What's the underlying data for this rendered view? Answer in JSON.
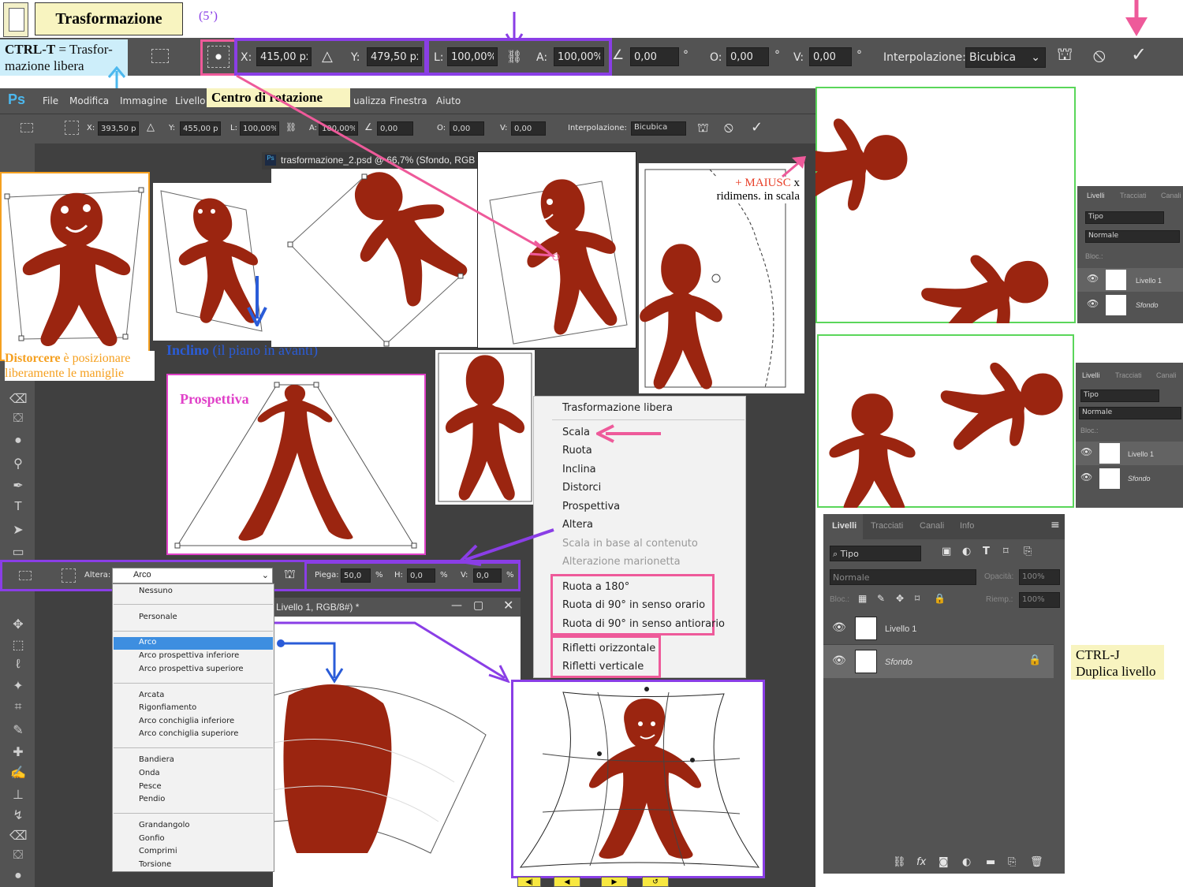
{
  "header": {
    "title": "Trasformazione",
    "time_note": "(5’)",
    "shortcut_key": "CTRL-T",
    "shortcut_desc_1": " = Trasfor-",
    "shortcut_desc_2": "mazione libera"
  },
  "options_bar": {
    "x_label": "X:",
    "x_value": "415,00 px",
    "y_label": "Y:",
    "y_value": "479,50 px",
    "w_label": "L:",
    "w_value": "100,00%",
    "h_label": "A:",
    "h_value": "100,00%",
    "angle_value": "0,00",
    "deg": "°",
    "hskew_label": "O:",
    "hskew_value": "0,00",
    "vskew_label": "V:",
    "vskew_value": "0,00",
    "interp_label": "Interpolazione:",
    "interp_value": "Bicubica"
  },
  "ps_menu": {
    "logo": "Ps",
    "items": [
      "File",
      "Modifica",
      "Immagine",
      "Livello",
      "Visualizza",
      "Finestra",
      "Aiuto"
    ],
    "items_suffix": "ualizza"
  },
  "small_options_bar": {
    "x_label": "X:",
    "x_value": "393,50 px",
    "y_label": "Y:",
    "y_value": "455,00 px",
    "w_label": "L:",
    "w_value": "100,00%",
    "h_label": "A:",
    "h_value": "100,00%",
    "angle_value": "0,00",
    "hskew_label": "O:",
    "hskew_value": "0,00",
    "vskew_label": "V:",
    "vskew_value": "0,00",
    "interp_label": "Interpolazione:",
    "interp_value": "Bicubica"
  },
  "callouts": {
    "rotation_center": "Centro di rotazione",
    "shift_1": "+ MAIUSC",
    "shift_2": " x",
    "shift_3": "ridimens. in scala",
    "distort_bold": "Distorcere",
    "distort_rest": " è posizionare",
    "distort_line2": "liberamente le maniglie",
    "skew_bold": "Inclino",
    "skew_rest": " (il piano in avanti)",
    "perspective": "Prospettiva",
    "ctrlj_1": "CTRL-J",
    "ctrlj_2": "Duplica livello"
  },
  "doc_tab": {
    "title": "trasformazione_2.psd @ 66,7% (Sfondo, RGB",
    "title2": "Livello 1, RGB/8#) *"
  },
  "context_menu": {
    "items": [
      "Trasformazione libera",
      "Scala",
      "Ruota",
      "Inclina",
      "Distorci",
      "Prospettiva",
      "Altera"
    ],
    "disabled": [
      "Scala in base al contenuto",
      "Alterazione marionetta"
    ],
    "rotate": [
      "Ruota a 180°",
      "Ruota di 90° in senso orario",
      "Ruota di 90° in senso antiorario"
    ],
    "flip": [
      "Rifletti orizzontale",
      "Rifletti verticale"
    ]
  },
  "warp_bar": {
    "label": "Altera:",
    "value": "Arco",
    "bend_label": "Piega:",
    "bend_value": "50,0",
    "pct": "%",
    "h_label": "H:",
    "h_value": "0,0",
    "v_label": "V:",
    "v_value": "0,0"
  },
  "warp_menu": {
    "none": "Nessuno",
    "custom": "Personale",
    "group1": [
      "Arco",
      "Arco prospettiva inferiore",
      "Arco prospettiva superiore"
    ],
    "group2": [
      "Arcata",
      "Rigonfiamento",
      "Arco conchiglia inferiore",
      "Arco conchiglia superiore"
    ],
    "group3": [
      "Bandiera",
      "Onda",
      "Pesce",
      "Pendio"
    ],
    "group4": [
      "Grandangolo",
      "Gonfio",
      "Comprimi",
      "Torsione"
    ]
  },
  "layers_small": {
    "tabs": [
      "Livelli",
      "Tracciati",
      "Canali"
    ],
    "filter": "Tipo",
    "blend": "Normale",
    "lock": "Bloc.:",
    "layer1": "Livello 1",
    "background": "Sfondo"
  },
  "layers_panel": {
    "tabs": [
      "Livelli",
      "Tracciati",
      "Canali",
      "Info"
    ],
    "filter": "Tipo",
    "blend": "Normale",
    "opacity_label": "Opacità:",
    "opacity_value": "100%",
    "lock_label": "Bloc.:",
    "fill_label": "Riemp.:",
    "fill_value": "100%",
    "layer1": "Livello 1",
    "background": "Sfondo"
  },
  "colors": {
    "figure": "#9b2510",
    "purple": "#8a3ee6",
    "pink": "#ee5a9a",
    "green": "#5ad65a",
    "orange": "#f5a020",
    "blue": "#2a5cd8",
    "ps_dark": "#535353"
  }
}
